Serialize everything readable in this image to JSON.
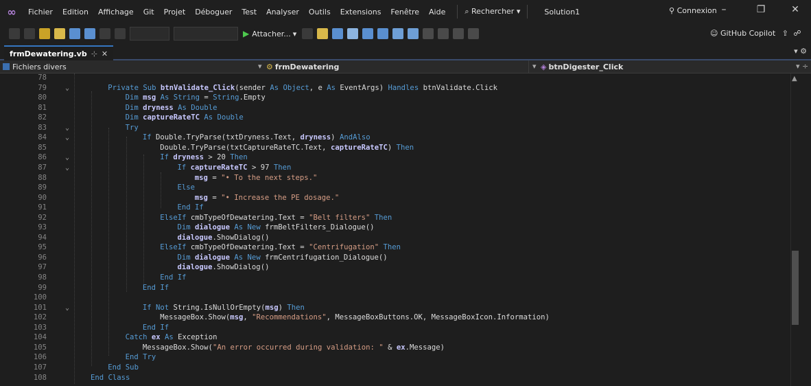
{
  "menubar": {
    "items": [
      "Fichier",
      "Edition",
      "Affichage",
      "Git",
      "Projet",
      "Déboguer",
      "Test",
      "Analyser",
      "Outils",
      "Extensions",
      "Fenêtre",
      "Aide"
    ],
    "search": "Rechercher",
    "solution": "Solution1",
    "account": "Connexion"
  },
  "toolbar": {
    "attach_label": "Attacher...",
    "copilot_label": "GitHub Copilot"
  },
  "tab": {
    "title": "frmDewatering.vb"
  },
  "navbar": {
    "project": "Fichiers divers",
    "class": "frmDewatering",
    "member": "btnDigester_Click"
  },
  "code_lines": [
    {
      "n": "78",
      "fold": false,
      "segments": []
    },
    {
      "n": "79",
      "fold": true,
      "segments": [
        [
          "kw",
          "Private Sub "
        ],
        [
          "idb",
          "btnValidate_Click"
        ],
        [
          "id",
          "(sender "
        ],
        [
          "kw",
          "As Object"
        ],
        [
          "id",
          ", e "
        ],
        [
          "kw",
          "As "
        ],
        [
          "id",
          "EventArgs) "
        ],
        [
          "kw",
          "Handles "
        ],
        [
          "id",
          "btnValidate.Click"
        ]
      ]
    },
    {
      "n": "80",
      "fold": false,
      "segments": [
        [
          "kw",
          "Dim "
        ],
        [
          "idb",
          "msg"
        ],
        [
          "kw",
          " As String "
        ],
        [
          "id",
          "= "
        ],
        [
          "kw",
          "String"
        ],
        [
          "id",
          ".Empty"
        ]
      ]
    },
    {
      "n": "81",
      "fold": false,
      "segments": [
        [
          "kw",
          "Dim "
        ],
        [
          "idb",
          "dryness"
        ],
        [
          "kw",
          " As Double"
        ]
      ]
    },
    {
      "n": "82",
      "fold": false,
      "segments": [
        [
          "kw",
          "Dim "
        ],
        [
          "idb",
          "captureRateTC"
        ],
        [
          "kw",
          " As Double"
        ]
      ]
    },
    {
      "n": "83",
      "fold": true,
      "segments": [
        [
          "kw",
          "Try"
        ]
      ]
    },
    {
      "n": "84",
      "fold": true,
      "segments": [
        [
          "kw",
          "If "
        ],
        [
          "id",
          "Double.TryParse(txtDryness.Text, "
        ],
        [
          "idb",
          "dryness"
        ],
        [
          "id",
          ") "
        ],
        [
          "kw",
          "AndAlso"
        ]
      ]
    },
    {
      "n": "85",
      "fold": false,
      "segments": [
        [
          "id",
          "Double.TryParse(txtCaptureRateTC.Text, "
        ],
        [
          "idb",
          "captureRateTC"
        ],
        [
          "id",
          ") "
        ],
        [
          "kw",
          "Then"
        ]
      ]
    },
    {
      "n": "86",
      "fold": true,
      "segments": [
        [
          "kw",
          "If "
        ],
        [
          "idb",
          "dryness"
        ],
        [
          "id",
          " > 20 "
        ],
        [
          "kw",
          "Then"
        ]
      ]
    },
    {
      "n": "87",
      "fold": true,
      "segments": [
        [
          "kw",
          "If "
        ],
        [
          "idb",
          "captureRateTC"
        ],
        [
          "id",
          " > 97 "
        ],
        [
          "kw",
          "Then"
        ]
      ]
    },
    {
      "n": "88",
      "fold": false,
      "segments": [
        [
          "idb",
          "msg"
        ],
        [
          "id",
          " = "
        ],
        [
          "str",
          "\"• To the next steps.\""
        ]
      ]
    },
    {
      "n": "89",
      "fold": false,
      "segments": [
        [
          "kw",
          "Else"
        ]
      ]
    },
    {
      "n": "90",
      "fold": false,
      "segments": [
        [
          "idb",
          "msg"
        ],
        [
          "id",
          " = "
        ],
        [
          "str",
          "\"• Increase the PE dosage.\""
        ]
      ]
    },
    {
      "n": "91",
      "fold": false,
      "segments": [
        [
          "kw",
          "End If"
        ]
      ]
    },
    {
      "n": "92",
      "fold": false,
      "segments": [
        [
          "kw",
          "ElseIf "
        ],
        [
          "id",
          "cmbTypeOfDewatering.Text = "
        ],
        [
          "str",
          "\"Belt filters\""
        ],
        [
          "kw",
          " Then"
        ]
      ]
    },
    {
      "n": "93",
      "fold": false,
      "segments": [
        [
          "kw",
          "Dim "
        ],
        [
          "idb",
          "dialogue"
        ],
        [
          "kw",
          " As New "
        ],
        [
          "id",
          "frmBeltFilters_Dialogue()"
        ]
      ]
    },
    {
      "n": "94",
      "fold": false,
      "segments": [
        [
          "idb",
          "dialogue"
        ],
        [
          "id",
          ".ShowDialog()"
        ]
      ]
    },
    {
      "n": "95",
      "fold": false,
      "segments": [
        [
          "kw",
          "ElseIf "
        ],
        [
          "id",
          "cmbTypeOfDewatering.Text = "
        ],
        [
          "str",
          "\"Centrifugation\""
        ],
        [
          "kw",
          " Then"
        ]
      ]
    },
    {
      "n": "96",
      "fold": false,
      "segments": [
        [
          "kw",
          "Dim "
        ],
        [
          "idb",
          "dialogue"
        ],
        [
          "kw",
          " As New "
        ],
        [
          "id",
          "frmCentrifugation_Dialogue()"
        ]
      ]
    },
    {
      "n": "97",
      "fold": false,
      "segments": [
        [
          "idb",
          "dialogue"
        ],
        [
          "id",
          ".ShowDialog()"
        ]
      ]
    },
    {
      "n": "98",
      "fold": false,
      "segments": [
        [
          "kw",
          "End If"
        ]
      ]
    },
    {
      "n": "99",
      "fold": false,
      "segments": [
        [
          "kw",
          "End If"
        ]
      ]
    },
    {
      "n": "100",
      "fold": false,
      "segments": []
    },
    {
      "n": "101",
      "fold": true,
      "segments": [
        [
          "kw",
          "If Not "
        ],
        [
          "id",
          "String.IsNullOrEmpty("
        ],
        [
          "idb",
          "msg"
        ],
        [
          "id",
          ") "
        ],
        [
          "kw",
          "Then"
        ]
      ]
    },
    {
      "n": "102",
      "fold": false,
      "segments": [
        [
          "id",
          "MessageBox.Show("
        ],
        [
          "idb",
          "msg"
        ],
        [
          "id",
          ", "
        ],
        [
          "str",
          "\"Recommendations\""
        ],
        [
          "id",
          ", MessageBoxButtons.OK, MessageBoxIcon.Information)"
        ]
      ]
    },
    {
      "n": "103",
      "fold": false,
      "segments": [
        [
          "kw",
          "End If"
        ]
      ]
    },
    {
      "n": "104",
      "fold": false,
      "segments": [
        [
          "kw",
          "Catch "
        ],
        [
          "idb",
          "ex"
        ],
        [
          "kw",
          " As "
        ],
        [
          "id",
          "Exception"
        ]
      ]
    },
    {
      "n": "105",
      "fold": false,
      "segments": [
        [
          "id",
          "MessageBox.Show("
        ],
        [
          "str",
          "\"An error occurred during validation: \""
        ],
        [
          "id",
          " & "
        ],
        [
          "idb",
          "ex"
        ],
        [
          "id",
          ".Message)"
        ]
      ]
    },
    {
      "n": "106",
      "fold": false,
      "segments": [
        [
          "kw",
          "End Try"
        ]
      ]
    },
    {
      "n": "107",
      "fold": false,
      "segments": [
        [
          "kw",
          "End Sub"
        ]
      ]
    },
    {
      "n": "108",
      "fold": false,
      "segments": [
        [
          "kw",
          "End Class"
        ]
      ]
    }
  ]
}
